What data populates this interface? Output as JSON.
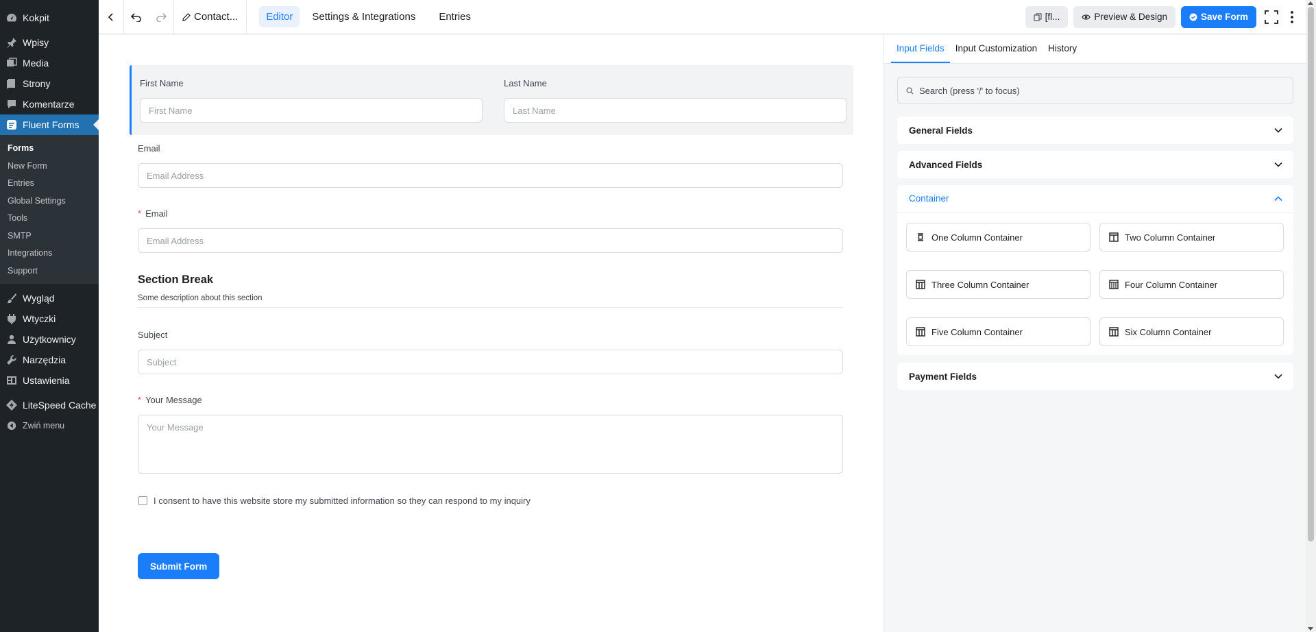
{
  "sidebar": {
    "items_top": [
      {
        "label": "Kokpit",
        "icon": "dashboard-icon"
      }
    ],
    "items_mid": [
      {
        "label": "Wpisy",
        "icon": "pin-icon"
      },
      {
        "label": "Media",
        "icon": "media-icon"
      },
      {
        "label": "Strony",
        "icon": "pages-icon"
      },
      {
        "label": "Komentarze",
        "icon": "comments-icon"
      }
    ],
    "current": {
      "label": "Fluent Forms",
      "icon": "fluent-forms-icon"
    },
    "submenu": [
      "Forms",
      "New Form",
      "Entries",
      "Global Settings",
      "Tools",
      "SMTP",
      "Integrations",
      "Support"
    ],
    "items_bottom": [
      {
        "label": "Wygląd",
        "icon": "brush-icon"
      },
      {
        "label": "Wtyczki",
        "icon": "plugins-icon"
      },
      {
        "label": "Użytkownicy",
        "icon": "users-icon"
      },
      {
        "label": "Narzędzia",
        "icon": "tools-icon"
      },
      {
        "label": "Ustawienia",
        "icon": "settings-icon"
      }
    ],
    "litespeed": "LiteSpeed Cache",
    "collapse": "Zwiń menu"
  },
  "topbar": {
    "form_title": "Contact...",
    "tabs": [
      "Editor",
      "Settings & Integrations",
      "Entries"
    ],
    "shortcode": "[fl...",
    "preview": "Preview & Design",
    "save": "Save Form"
  },
  "form": {
    "first_name_label": "First Name",
    "first_name_placeholder": "First Name",
    "last_name_label": "Last Name",
    "last_name_placeholder": "Last Name",
    "email1_label": "Email",
    "email1_placeholder": "Email Address",
    "email2_required": "*",
    "email2_label": "Email",
    "email2_placeholder": "Email Address",
    "section_title": "Section Break",
    "section_desc": "Some description about this section",
    "subject_label": "Subject",
    "subject_placeholder": "Subject",
    "message_required": "*",
    "message_label": "Your Message",
    "message_placeholder": "Your Message",
    "consent": "I consent to have this website store my submitted information so they can respond to my inquiry",
    "submit": "Submit Form"
  },
  "panel": {
    "tabs": [
      "Input Fields",
      "Input Customization",
      "History"
    ],
    "search_placeholder": "Search (press '/' to focus)",
    "general": "General Fields",
    "advanced": "Advanced Fields",
    "container": "Container",
    "containers": [
      "One Column Container",
      "Two Column Container",
      "Three Column Container",
      "Four Column Container",
      "Five Column Container",
      "Six Column Container"
    ],
    "payment": "Payment Fields"
  },
  "colors": {
    "accent": "#1a7efb",
    "wp_sidebar": "#1d2327",
    "wp_current": "#2271b1"
  }
}
